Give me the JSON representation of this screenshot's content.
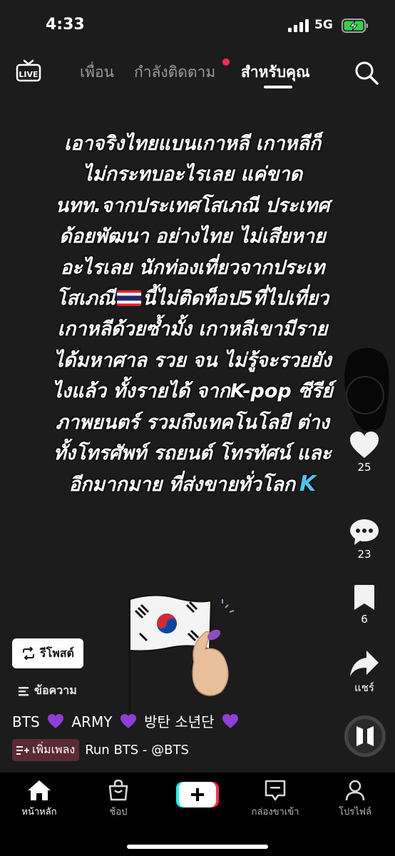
{
  "status_bar": {
    "time": "4:33",
    "network": "5G"
  },
  "top_nav": {
    "tabs": [
      "เพื่อน",
      "กำลังติดตาม",
      "สำหรับคุณ"
    ],
    "active_tab": "สำหรับคุณ"
  },
  "caption": {
    "lines": [
      "เอาจริงไทยแบนเกาหลี เกาหลีก็",
      "ไม่กระทบอะไรเลย  แค่ขาด",
      "นทท.จากประเทศโสเภณี ประเทศ",
      "ด้อยพัฒนา อย่างไทย ไม่เสียหาย",
      "อะไรเลย นักท่องเที่ยวจากประเท",
      "โสเภณี",
      "นี้ไม่ติดท็อป5ที่ไปเที่ยว",
      "เกาหลีด้วยซ้ำมั้ง เกาหลีเขามีราย",
      "ได้มหาศาล รวย จน ไม่รู้จะรวยยัง",
      "ไงแล้ว ทั้งรายได้ จากK-pop ซีรีย์",
      "ภาพยนตร์ รวมถึงเทคโนโลยี ต่าง",
      "ทั้งโทรศัพท์ รถยนต์ โทรทัศน์ และ",
      "อีกมากมาย ที่ส่งขายทั่วโลก",
      "K"
    ]
  },
  "actions": {
    "likes": "25",
    "comments": "23",
    "saves": "6",
    "share_label": "แชร์"
  },
  "repost_label": "รีโพสต์",
  "message_label": "ข้อความ",
  "post_title": {
    "part1": "BTS",
    "part2": "ARMY",
    "part3": "방탄 소년단"
  },
  "music": {
    "add_label": "เพิ่มเพลง",
    "track": "Run BTS - @BTS"
  },
  "bottom_nav": {
    "home": "หน้าหลัก",
    "shop": "ช้อป",
    "inbox": "กล่องขาเข้า",
    "profile": "โปรไฟล์"
  },
  "colors": {
    "accent_red": "#fe2c55",
    "accent_cyan": "#25f4ee",
    "heart_purple": "#8e3fd8",
    "k_blue": "#4ec3f0"
  }
}
